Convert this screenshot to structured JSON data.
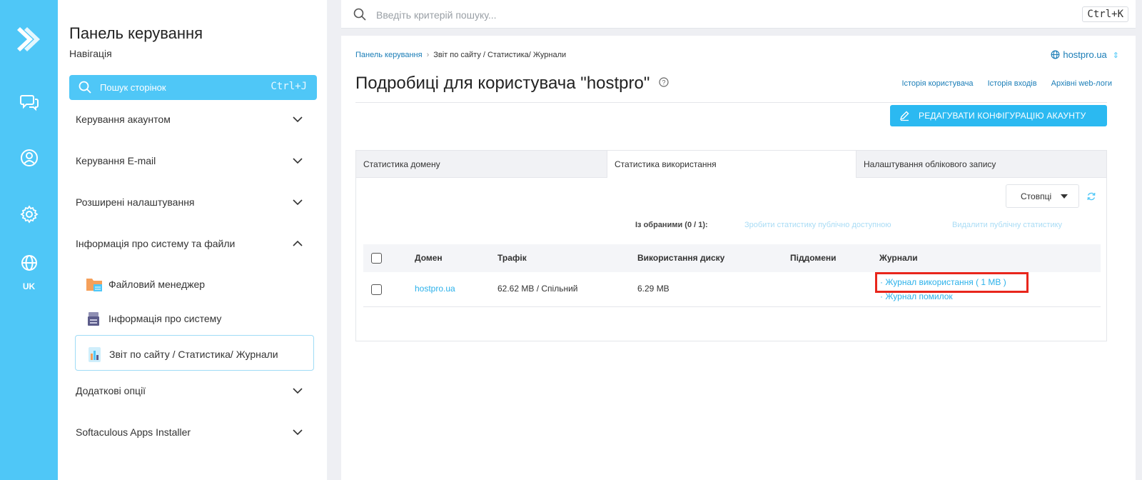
{
  "rail": {
    "items": [
      {
        "icon": "chat-icon"
      },
      {
        "icon": "user-icon"
      },
      {
        "icon": "gear-icon"
      },
      {
        "icon": "globe-icon"
      }
    ],
    "lang": "UK",
    "color": "#4fc7f7"
  },
  "sidebar": {
    "title": "Панель керування",
    "subtitle": "Навігація",
    "search": {
      "placeholder": "Пошук сторінок",
      "shortcut": "Ctrl+J"
    },
    "sections": [
      {
        "label": "Керування акаунтом",
        "expanded": false
      },
      {
        "label": "Керування E-mail",
        "expanded": false
      },
      {
        "label": "Розширені налаштування",
        "expanded": false
      },
      {
        "label": "Інформація про систему та файли",
        "expanded": true
      },
      {
        "label": "Додаткові опції",
        "expanded": false
      },
      {
        "label": "Softaculous Apps Installer",
        "expanded": false
      }
    ],
    "subitems": [
      {
        "label": "Файловий менеджер",
        "icon": "folder-icon"
      },
      {
        "label": "Інформація про систему",
        "icon": "server-icon"
      },
      {
        "label": "Звіт по сайту / Статистика/ Журнали",
        "icon": "report-icon",
        "active": true
      }
    ]
  },
  "topbar": {
    "search_placeholder": "Введіть критерій пошуку...",
    "shortcut": "Ctrl+K"
  },
  "breadcrumb": [
    "Панель керування",
    "Звіт по сайту / Статистика/ Журнали"
  ],
  "domain_selector": "hostpro.ua",
  "page": {
    "title": "Подробиці для користувача \"hostpro\"",
    "links": [
      "Історія користувача",
      "Історія входів",
      "Архівні web-логи"
    ],
    "edit_button": "РЕДАГУВАТИ КОНФІГУРАЦІЮ АКАУНТУ"
  },
  "tabs": [
    "Статистика домену",
    "Статистика використання",
    "Налаштування облікового запису"
  ],
  "table": {
    "columns_button": "Стовпці",
    "bulk": {
      "label": "Із обраними (0 / 1):",
      "actions": [
        "Зробити статистику публічно доступною",
        "Видалити публічну статистику"
      ]
    },
    "headers": [
      "Домен",
      "Трафік",
      "Використання диску",
      "Піддомени",
      "Журнали"
    ],
    "rows": [
      {
        "domain": "hostpro.ua",
        "traffic": "62.62 MB / Спільний",
        "disk": "6.29 MB",
        "subdomains": "",
        "logs": [
          "· Журнал використання ( 1 MB )",
          "· Журнал помилок"
        ]
      }
    ]
  },
  "colors": {
    "accent": "#4fc7f7",
    "link": "#1a7db7",
    "button": "#2bb9f1",
    "highlight": "#e8261c"
  }
}
